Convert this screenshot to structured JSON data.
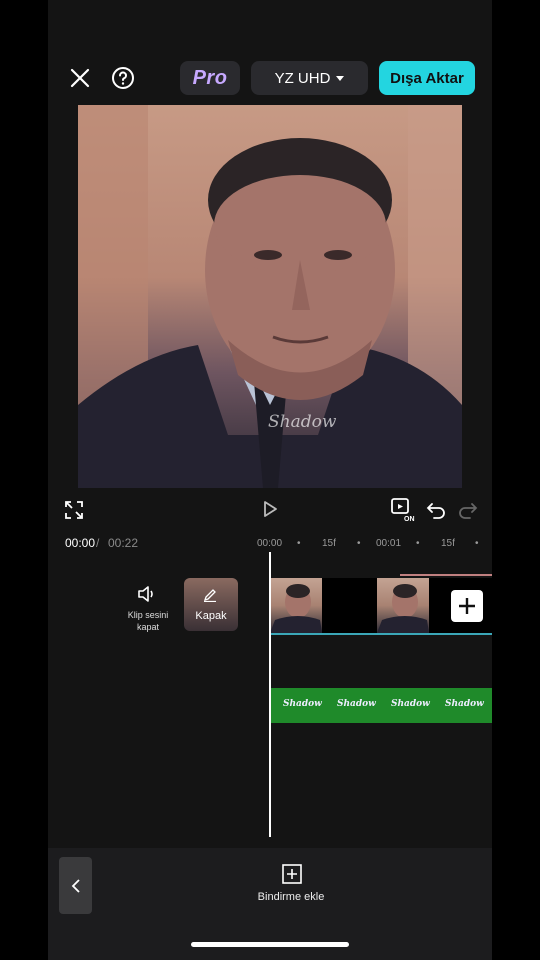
{
  "toolbar": {
    "pro_label": "Pro",
    "quality_label": "YZ UHD",
    "export_label": "Dışa Aktar"
  },
  "preview": {
    "watermark": "Shadow"
  },
  "timeline": {
    "current_time": "00:00",
    "separator": "/",
    "total_time": "00:22",
    "ruler": [
      "00:00",
      "15f",
      "00:01",
      "15f"
    ],
    "ruler_dot": "•",
    "mute_label": "Klip sesini kapat",
    "cover_label": "Kapak",
    "text_items": [
      "Shadow",
      "Shadow",
      "Shadow",
      "Shadow"
    ]
  },
  "bottom": {
    "overlay_label": "Bindirme ekle"
  },
  "colors": {
    "accent": "#23d5e0",
    "text_track": "#1f8a2a",
    "pro": "#c7a9ff"
  },
  "icons": [
    "close-icon",
    "help-icon",
    "fullscreen-icon",
    "play-icon",
    "keyframe-on-icon",
    "undo-icon",
    "redo-icon",
    "speaker-icon",
    "edit-icon",
    "plus-icon",
    "overlay-add-icon",
    "chevron-left-icon"
  ]
}
